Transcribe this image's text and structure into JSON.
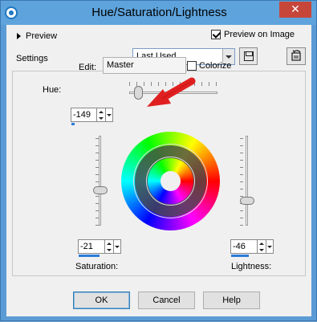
{
  "window": {
    "title": "Hue/Saturation/Lightness",
    "close_glyph": "✕"
  },
  "preview": {
    "label": "Preview",
    "on_image_label": "Preview on Image",
    "on_image_checked": true
  },
  "settings": {
    "label": "Settings",
    "preset_value": "Last Used"
  },
  "edit": {
    "label": "Edit:",
    "value": "Master",
    "colorize_label": "Colorize",
    "colorize_checked": false
  },
  "hue": {
    "label": "Hue:",
    "value": "-149"
  },
  "saturation": {
    "label": "Saturation:",
    "value": "-21"
  },
  "lightness": {
    "label": "Lightness:",
    "value": "-46"
  },
  "buttons": {
    "ok": "OK",
    "cancel": "Cancel",
    "help": "Help"
  },
  "colors": {
    "accent": "#2b7bd8",
    "arrow": "#e02020",
    "titlebar": "#5ea3dc"
  }
}
